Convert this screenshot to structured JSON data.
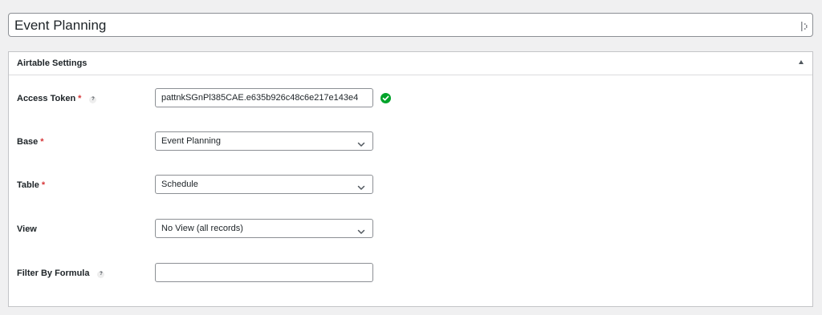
{
  "post_title": "Event Planning",
  "panel": {
    "title": "Airtable Settings"
  },
  "fields": {
    "access_token": {
      "label": "Access Token",
      "required": "*",
      "help": "?",
      "value": "pattnkSGnPl385CAE.e635b926c48c6e217e143e4"
    },
    "base": {
      "label": "Base",
      "required": "*",
      "value": "Event Planning"
    },
    "table": {
      "label": "Table",
      "required": "*",
      "value": "Schedule"
    },
    "view": {
      "label": "View",
      "value": "No View (all records)"
    },
    "filter": {
      "label": "Filter By Formula",
      "help": "?",
      "value": ""
    }
  },
  "colors": {
    "accent": "#2271b1",
    "required": "#d63638",
    "success": "#00a32a"
  },
  "icons": {
    "title_right": "drag-handle-icon",
    "panel_toggle": "collapse-arrow-icon",
    "token_valid": "check-circle-icon",
    "select_arrow": "chevron-down-icon"
  }
}
